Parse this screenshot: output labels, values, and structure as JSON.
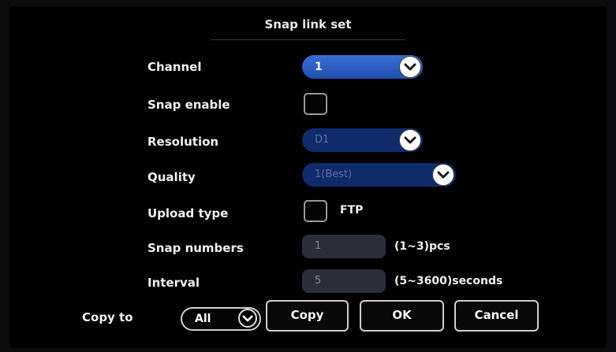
{
  "dialog": {
    "title": "Snap link set"
  },
  "form": {
    "channel": {
      "label": "Channel",
      "value": "1"
    },
    "snap_enable": {
      "label": "Snap enable",
      "checked": false
    },
    "resolution": {
      "label": "Resolution",
      "value": "D1"
    },
    "quality": {
      "label": "Quality",
      "value": "1(Best)"
    },
    "upload_type": {
      "label": "Upload type",
      "checked": false,
      "option": "FTP"
    },
    "snap_numbers": {
      "label": "Snap numbers",
      "value": "1",
      "hint": "(1~3)pcs"
    },
    "interval": {
      "label": "Interval",
      "value": "5",
      "hint": "(5~3600)seconds"
    }
  },
  "footer": {
    "copy_to_label": "Copy to",
    "copy_to_value": "All",
    "copy_label": "Copy",
    "ok_label": "OK",
    "cancel_label": "Cancel"
  },
  "icons": {
    "dropdown": "chevron-down-icon"
  },
  "colors": {
    "active_combo": "#2f63c8",
    "disabled_combo": "#0f2b6b",
    "field_bg": "#2b2f3c"
  }
}
